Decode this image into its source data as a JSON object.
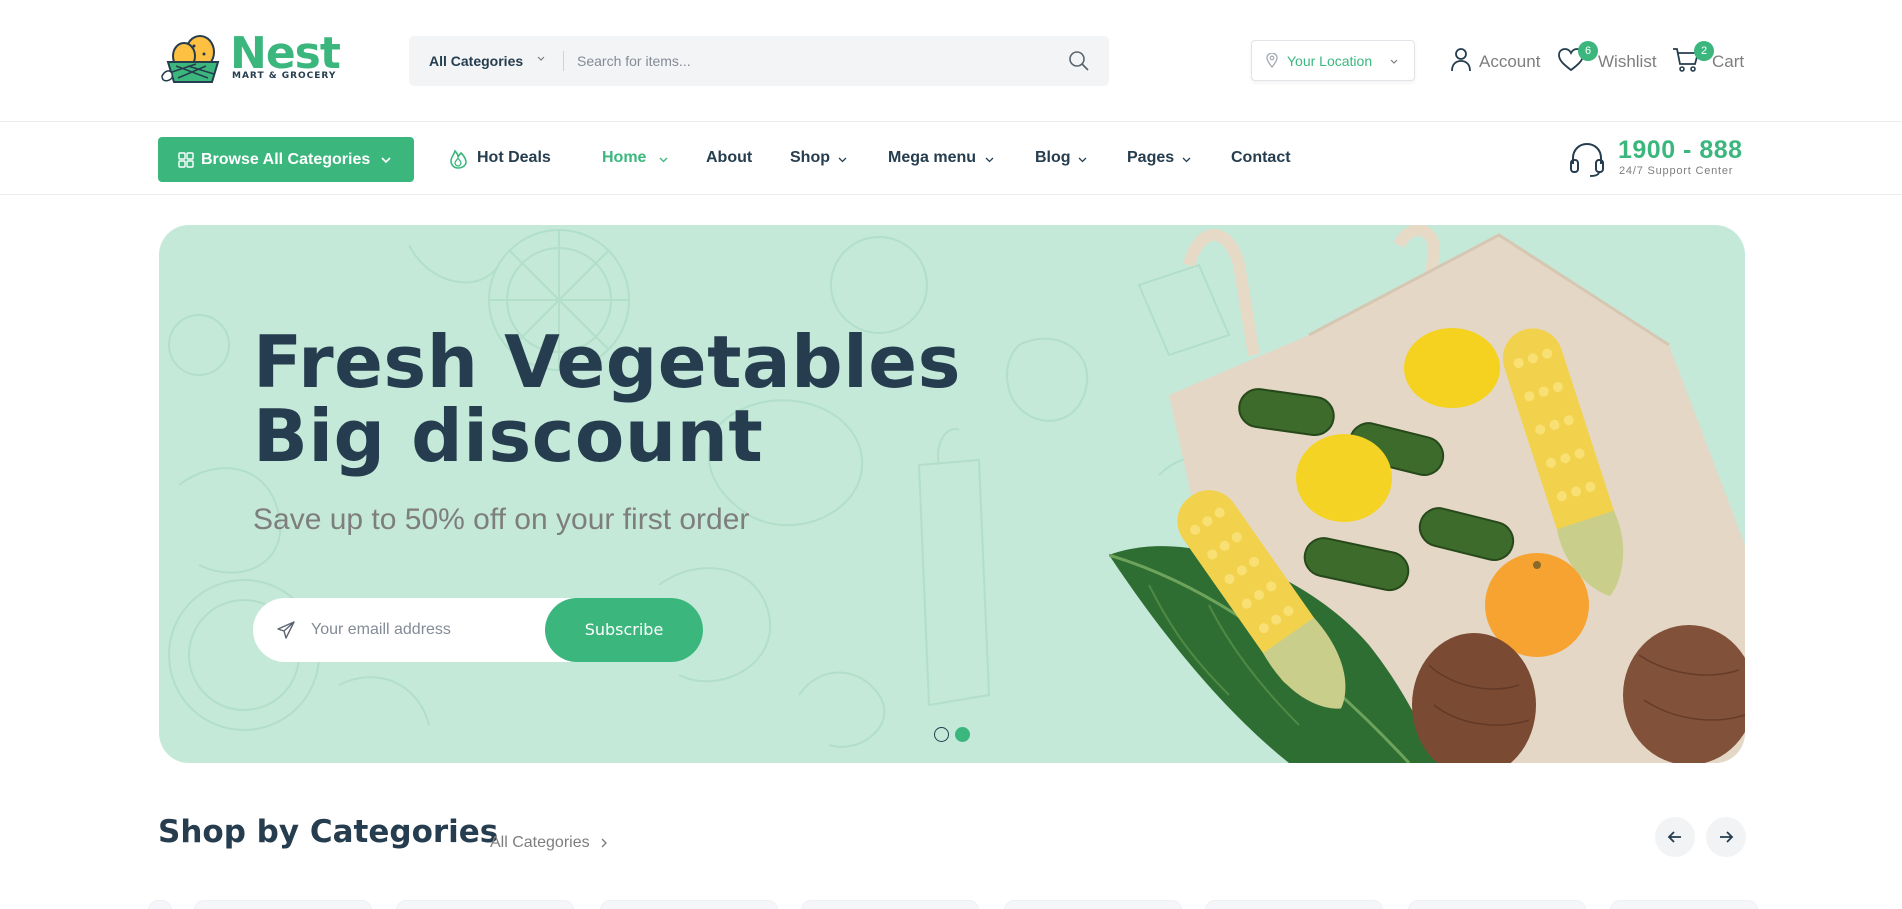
{
  "brand": {
    "name": "Nest",
    "tagline": "MART & GROCERY"
  },
  "search": {
    "category": "All Categories",
    "placeholder": "Search for items..."
  },
  "location": {
    "label": "Your Location"
  },
  "header_actions": {
    "account": "Account",
    "wishlist": "Wishlist",
    "wishlist_count": "6",
    "cart": "Cart",
    "cart_count": "2"
  },
  "nav": {
    "browse": "Browse  All Categories",
    "hot_deals": "Hot Deals",
    "items": [
      "Home",
      "About",
      "Shop",
      "Mega menu",
      "Blog",
      "Pages",
      "Contact"
    ],
    "active": "Home"
  },
  "support": {
    "phone": "1900 - 888",
    "subtitle": "24/7 Support Center"
  },
  "hero": {
    "title_line1": "Fresh Vegetables",
    "title_line2": "Big discount",
    "subtitle": "Save up to 50% off on your first order",
    "email_placeholder": "Your emaill address",
    "button": "Subscribe",
    "slides_total": 2,
    "active_slide": 2
  },
  "categories": {
    "title": "Shop by Categories",
    "link": "All Categories"
  },
  "colors": {
    "brand_green": "#3bb77e",
    "heading": "#253d4e",
    "muted": "#7e7e7e",
    "hero_bg": "#c4e9d9"
  }
}
